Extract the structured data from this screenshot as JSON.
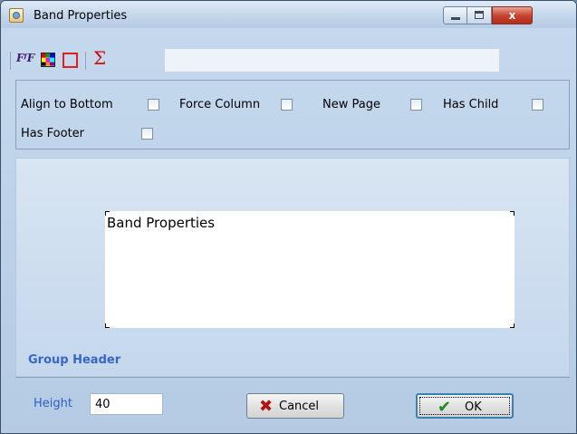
{
  "window": {
    "title": "Band Properties"
  },
  "titlebar_buttons": {
    "minimize": "",
    "maximize": "",
    "close": "x"
  },
  "toolbar": {
    "icons": [
      "font-style-icon",
      "color-palette-icon",
      "border-icon",
      "sigma-icon"
    ],
    "font_icon_text": "FᶠF",
    "sigma_text": "Σ",
    "expression_value": ""
  },
  "options": {
    "align_to_bottom": {
      "label": "Align to Bottom",
      "checked": false
    },
    "force_column": {
      "label": "Force Column",
      "checked": false
    },
    "new_page": {
      "label": "New Page",
      "checked": false
    },
    "has_child": {
      "label": "Has Child",
      "checked": false
    },
    "has_footer": {
      "label": "Has Footer",
      "checked": false
    }
  },
  "preview": {
    "band_text": "Band Properties",
    "band_type": "Group Header"
  },
  "footer": {
    "height_label": "Height",
    "height_value": "40",
    "cancel_label": "Cancel",
    "ok_label": "OK",
    "cancel_icon": "✖",
    "ok_icon": "✔"
  },
  "colors": {
    "accent_label": "#2d5fc4",
    "group_header": "#3566c9",
    "close_button": "#c7452f"
  }
}
